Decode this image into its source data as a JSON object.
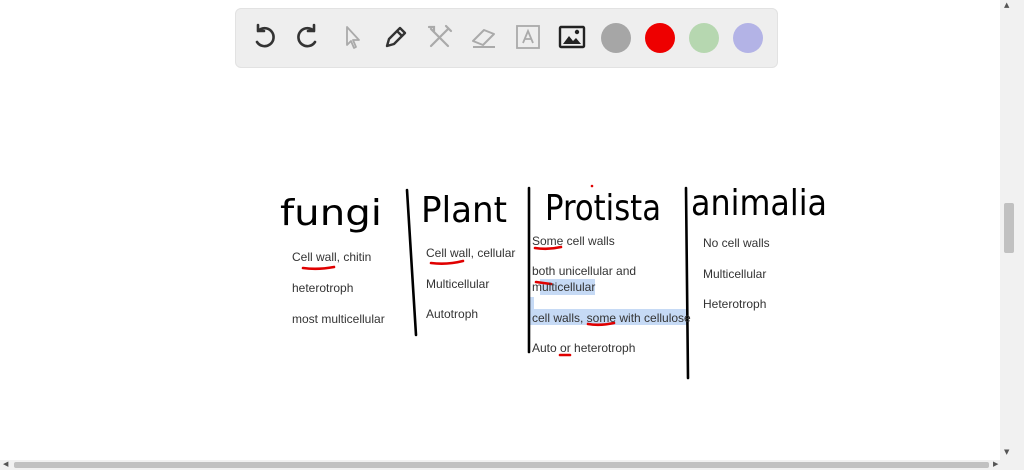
{
  "toolbar": {
    "tools": [
      "undo-icon",
      "redo-icon",
      "pointer-icon",
      "pen-icon",
      "tools-icon",
      "eraser-icon",
      "text-icon",
      "image-icon"
    ],
    "colors": [
      "#a6a6a6",
      "#ee0000",
      "#b6d7b0",
      "#b3b3e6"
    ]
  },
  "board": {
    "headings": [
      "fungi",
      "Plant",
      "Protista",
      "animalia"
    ],
    "fungi": [
      "Cell wall, chitin",
      "heterotroph",
      "most multicellular"
    ],
    "plant": [
      "Cell wall, cellular",
      "Multicellular",
      "Autotroph"
    ],
    "protista": [
      "Some cell walls",
      "both unicellular and",
      "multicellular",
      "cell walls, some with cellulose",
      "Auto or heterotroph"
    ],
    "animalia": [
      "No cell walls",
      "Multicellular",
      "Heterotroph"
    ]
  }
}
